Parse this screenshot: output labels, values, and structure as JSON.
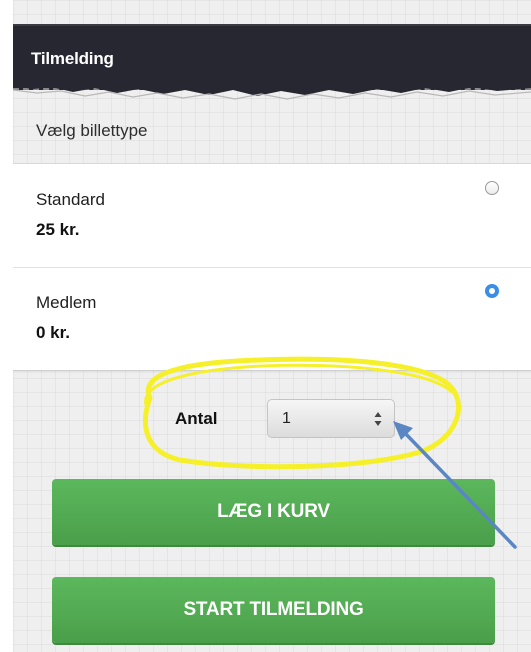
{
  "header": {
    "title": "Tilmelding"
  },
  "ticket_section": {
    "subtitle": "Vælg billettype",
    "tickets": [
      {
        "name": "Standard",
        "price": "25 kr.",
        "selected": false
      },
      {
        "name": "Medlem",
        "price": "0 kr.",
        "selected": true
      }
    ]
  },
  "quantity": {
    "label": "Antal",
    "value": "1"
  },
  "buttons": {
    "add_to_cart": "LÆG I KURV",
    "start_registration": "START TILMELDING"
  },
  "colors": {
    "header_bg": "#262730",
    "button_green": "#5cb85c",
    "radio_selected": "#3a8ee6",
    "highlight_yellow": "#f5f02a",
    "arrow_blue": "#5b86c4"
  }
}
